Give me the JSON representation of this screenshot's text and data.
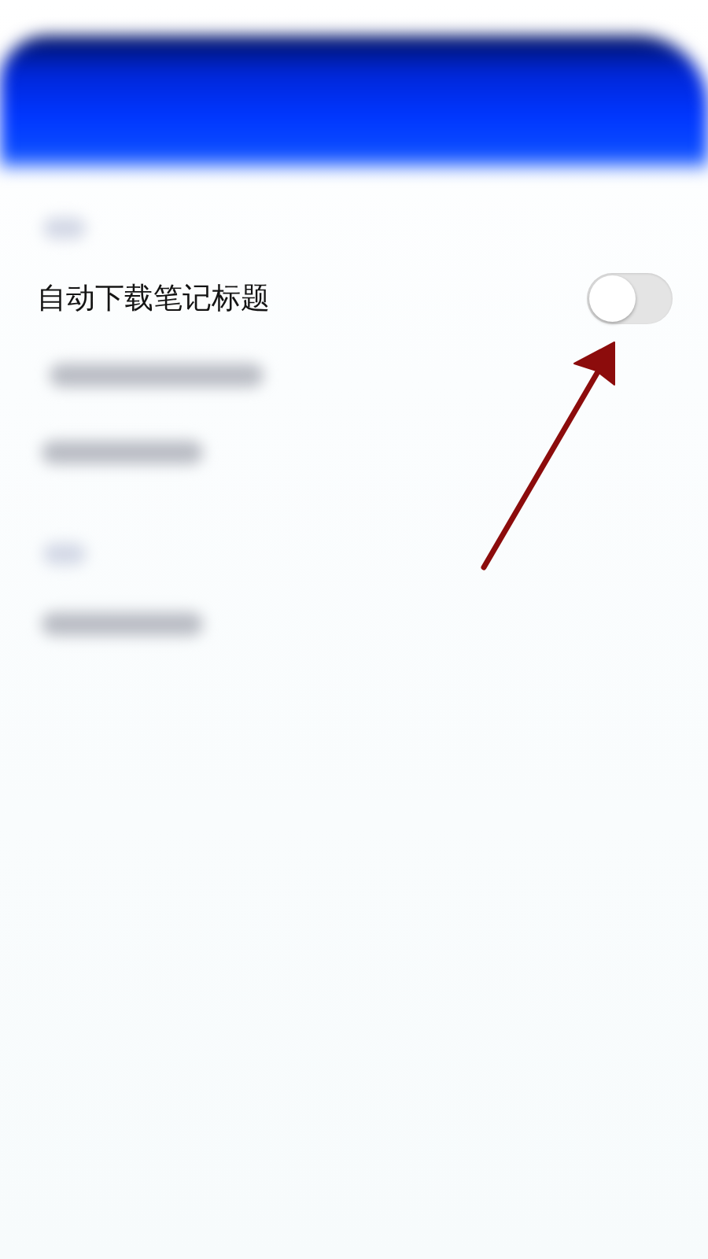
{
  "screen": {
    "header": {
      "kind": "blurred_bar"
    },
    "rows": [
      {
        "kind": "blurred_heading"
      },
      {
        "kind": "toggle",
        "label": "自动下载笔记标题",
        "on": false
      },
      {
        "kind": "blurred_long"
      },
      {
        "kind": "blurred_short"
      },
      {
        "kind": "blurred_heading"
      },
      {
        "kind": "blurred_short"
      }
    ]
  },
  "annotations": [
    {
      "kind": "arrow"
    }
  ]
}
